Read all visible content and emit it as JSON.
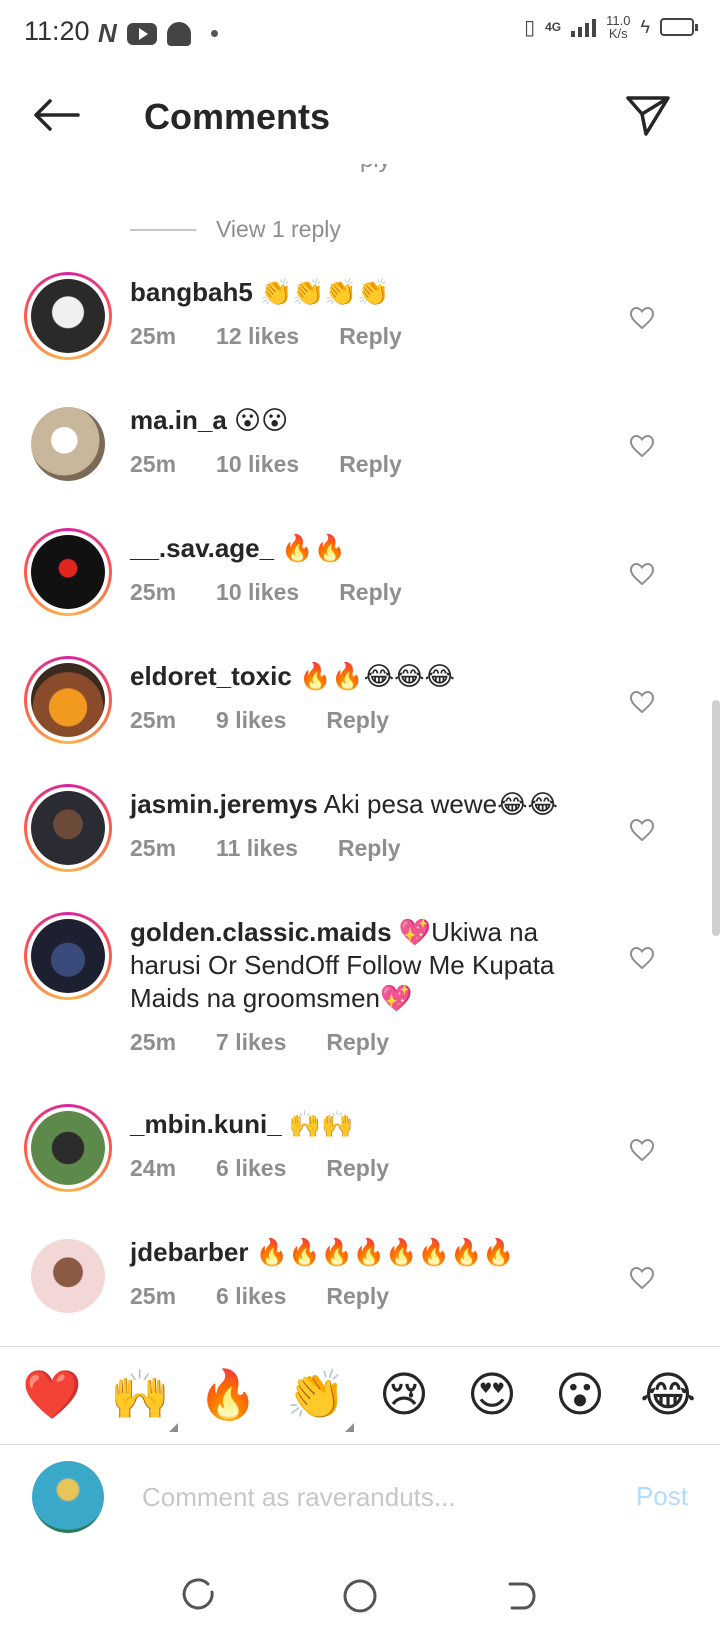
{
  "status_bar": {
    "time": "11:20",
    "network": "4G",
    "speed_value": "11.0",
    "speed_unit": "K/s"
  },
  "header": {
    "title": "Comments"
  },
  "thread": {
    "cut_text": "ply",
    "view_replies": "View 1 reply"
  },
  "comments": [
    {
      "username": "bangbah5",
      "text": " 👏👏👏👏",
      "time": "25m",
      "likes": "12 likes",
      "reply": "Reply"
    },
    {
      "username": "ma.in_a",
      "text": " 😮😮",
      "time": "25m",
      "likes": "10 likes",
      "reply": "Reply"
    },
    {
      "username": "__.sav.age_",
      "text": " 🔥🔥",
      "time": "25m",
      "likes": "10 likes",
      "reply": "Reply"
    },
    {
      "username": "eldoret_toxic",
      "text": " 🔥🔥😂😂😂",
      "time": "25m",
      "likes": "9 likes",
      "reply": "Reply"
    },
    {
      "username": "jasmin.jeremys",
      "text": " Aki pesa wewe😂😂",
      "time": "25m",
      "likes": "11 likes",
      "reply": "Reply"
    },
    {
      "username": "golden.classic.maids",
      "text": " 💖Ukiwa na harusi Or SendOff Follow Me Kupata Maids na groomsmen💖",
      "time": "25m",
      "likes": "7 likes",
      "reply": "Reply"
    },
    {
      "username": "_mbin.kuni_",
      "text": " 🙌🙌",
      "time": "24m",
      "likes": "6 likes",
      "reply": "Reply"
    },
    {
      "username": "jdebarber",
      "text": " 🔥🔥🔥🔥🔥🔥🔥🔥",
      "time": "25m",
      "likes": "6 likes",
      "reply": "Reply"
    }
  ],
  "emoji_bar": [
    "❤️",
    "🙌",
    "🔥",
    "👏",
    "😢",
    "😍",
    "😮",
    "😂"
  ],
  "composer": {
    "placeholder": "Comment as raveranduts...",
    "post_label": "Post"
  },
  "colors": {
    "text": "#262626",
    "secondary": "#8e8e8e",
    "post_disabled": "#b3dbff",
    "story_ring": [
      "#d6249f",
      "#fd5949",
      "#fdb44b"
    ]
  }
}
